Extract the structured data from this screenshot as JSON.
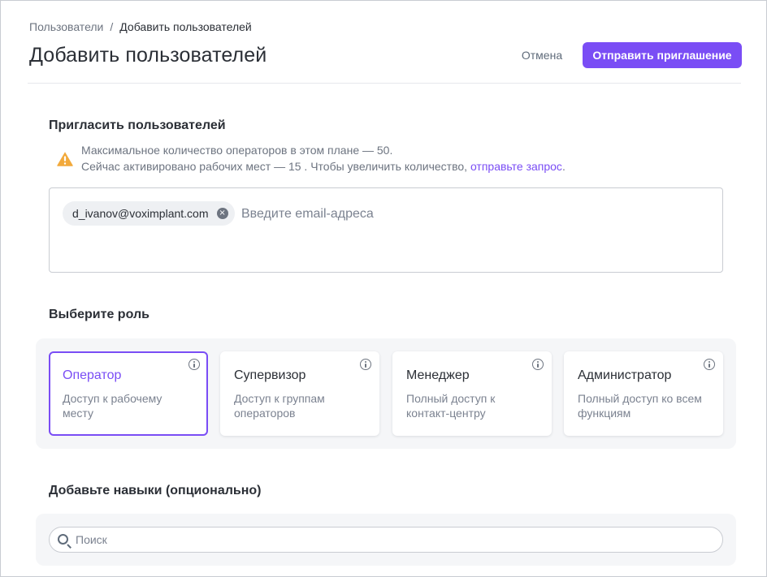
{
  "breadcrumb": {
    "parent": "Пользователи",
    "separator": "/",
    "current": "Добавить пользователей"
  },
  "header": {
    "title": "Добавить пользователей",
    "cancel_label": "Отмена",
    "submit_label": "Отправить приглашение"
  },
  "invite": {
    "section_title": "Пригласить пользователей",
    "notice_line1": "Максимальное количество операторов в этом плане — 50.",
    "notice_line2": "Сейчас активировано рабочих мест — 15 . Чтобы увеличить количество, ",
    "notice_link": "отправьте запрос",
    "notice_end": ".",
    "chip_email": "d_ivanov@voximplant.com",
    "chip_remove_glyph": "×",
    "email_placeholder": "Введите email-адреса"
  },
  "roles": {
    "section_title": "Выберите роль",
    "selected": "Оператор",
    "items": [
      {
        "name": "Оператор",
        "description": "Доступ к рабочему месту"
      },
      {
        "name": "Супервизор",
        "description": "Доступ к группам операторов"
      },
      {
        "name": "Менеджер",
        "description": "Полный доступ к контакт-центру"
      },
      {
        "name": "Администратор",
        "description": "Полный доступ ко всем функциям"
      }
    ]
  },
  "skills": {
    "section_title": "Добавьте навыки (опционально)",
    "search_placeholder": "Поиск"
  },
  "colors": {
    "accent": "#7a4df5",
    "warning": "#f2a93b"
  },
  "icons": {
    "warning": "warning-triangle-icon",
    "info": "info-icon",
    "search": "search-icon",
    "remove": "close-circle-icon"
  }
}
